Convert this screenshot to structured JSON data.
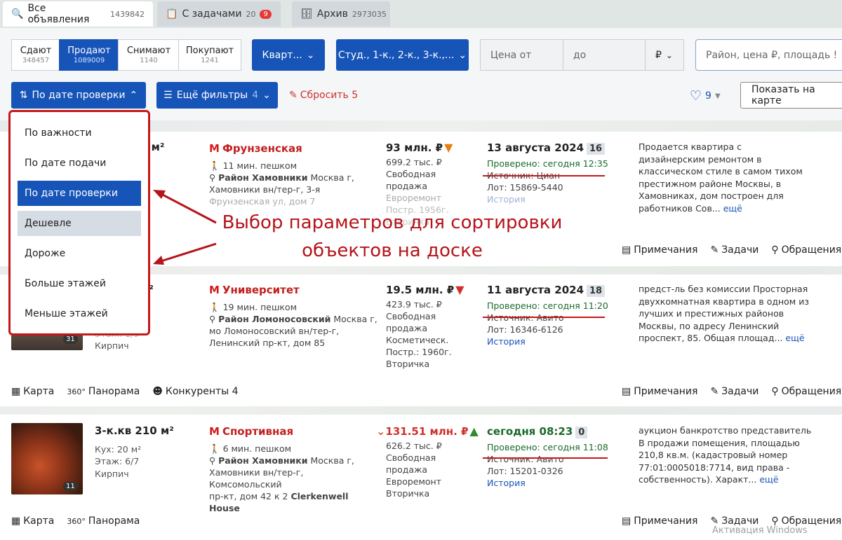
{
  "tabs": [
    {
      "label": "Все объявления",
      "count": "1439842"
    },
    {
      "label": "С задачами",
      "count": "20",
      "badge": "9"
    },
    {
      "label": "Архив",
      "count": "2973035"
    }
  ],
  "deal": [
    {
      "label": "Сдают",
      "count": "348457"
    },
    {
      "label": "Продают",
      "count": "1089009"
    },
    {
      "label": "Снимают",
      "count": "1140"
    },
    {
      "label": "Покупают",
      "count": "1241"
    }
  ],
  "filters": {
    "type": "Кварт...",
    "rooms": "Студ., 1-к., 2-к., 3-к.,...",
    "price_from": "Цена от",
    "price_to": "до",
    "currency": "₽",
    "search_placeholder": "Район, цена ₽, площадь !"
  },
  "toolbar": {
    "sort": "По дате проверки",
    "more": "Ещё фильтры",
    "more_count": "4",
    "reset": "Сбросить 5",
    "fav_count": "9",
    "show_map": "Показать на карте"
  },
  "sort_menu": [
    "По важности",
    "По дате подачи",
    "По дате проверки",
    "Дешевле",
    "Дороже",
    "Больше этажей",
    "Меньше этажей"
  ],
  "annotation": {
    "line1": "Выбор параметров для сортировки",
    "line2": "объектов на доске"
  },
  "listings": [
    {
      "area": "5 м²",
      "metro": "Фрунзенская",
      "walk": "11 мин. пешком",
      "district": "Район Хамовники",
      "address1": "Москва г,",
      "address2": "Хамовники вн/тер-г, 3-я",
      "address3": "Фрунзенская ул, дом 7",
      "price": "93 млн. ₽",
      "ppm": "699.2 тыс. ₽",
      "p1": "Свободная",
      "p2": "продажа",
      "p3": "Евроремонт",
      "p4": "Постр. 1956г.",
      "p5": "Вторичка",
      "date": "13 августа 2024",
      "date_count": "16",
      "checked_label": "Проверено:",
      "checked_time": "сегодня 12:35",
      "source": "Источник: Циан",
      "lot": "Лот: 15869-5440",
      "history": "История",
      "desc": [
        "Продается квартира с",
        "дизайнерским ремонтом в",
        "классическом стиле в самом тихом",
        "престижном районе Москвы, в",
        "Хамовниках, дом построен для",
        "работников Сов..."
      ],
      "more": "ещё"
    },
    {
      "area": "м²",
      "extra": "Этаж: 1/9",
      "material": "Кирпич",
      "metro": "Университет",
      "walk": "19 мин. пешком",
      "district": "Район Ломоносовский",
      "address1": "Москва г,",
      "address2": "мо Ломоносовский вн/тер-г,",
      "address3": "Ленинский пр-кт, дом 85",
      "price": "19.5 млн. ₽",
      "ppm": "423.9 тыс. ₽",
      "p1": "Свободная",
      "p2": "продажа",
      "p3": "Косметическ.",
      "p4": "Постр.: 1960г.",
      "p5": "Вторичка",
      "date": "11 августа 2024",
      "date_count": "18",
      "checked_label": "Проверено:",
      "checked_time": "сегодня 11:20",
      "source": "Источник: Авито",
      "lot": "Лот: 16346-6126",
      "history": "История",
      "desc": [
        "предст-ль без комиссии Просторная",
        "двухкомнатная квартира в одном из",
        "лучших и престижных районов",
        "Москвы, по адресу Ленинский",
        "проспект, 85. Общая площад..."
      ],
      "more": "ещё",
      "photo_count": "31"
    },
    {
      "title": "3-к.кв 210 м²",
      "kitchen": "Кух: 20 м²",
      "floor": "Этаж: 6/7",
      "material": "Кирпич",
      "metro": "Спортивная",
      "walk": "6 мин. пешком",
      "district": "Район Хамовники",
      "address1": "Москва г,",
      "address2": "Хамовники вн/тер-г, Комсомольский",
      "address3": "пр-кт, дом 42 к 2",
      "address_bold": "Clerkenwell House",
      "price": "131.51 млн. ₽",
      "ppm": "626.2 тыс. ₽",
      "p1": "Свободная",
      "p2": "продажа",
      "p3": "Евроремонт",
      "p5": "Вторичка",
      "date": "сегодня 08:23",
      "date_count": "0",
      "checked_label": "Проверено:",
      "checked_time": "сегодня 11:08",
      "source": "Источник: Авито",
      "lot": "Лот: 15201-0326",
      "history": "История",
      "desc": [
        "аукцион банкротство представитель",
        "В продажи помещения, площадью",
        "210,8 кв.м. (кадастровый номер",
        "77:01:0005018:7714, вид права -",
        "собственность). Характ..."
      ],
      "more": "ещё",
      "photo_count": "11"
    }
  ],
  "actions": {
    "map": "Карта",
    "pano": "Панорама",
    "competitors": "Конкуренты 4",
    "notes": "Примечания",
    "tasks": "Задачи",
    "requests": "Обращения"
  },
  "watermark": "Активация Windows"
}
